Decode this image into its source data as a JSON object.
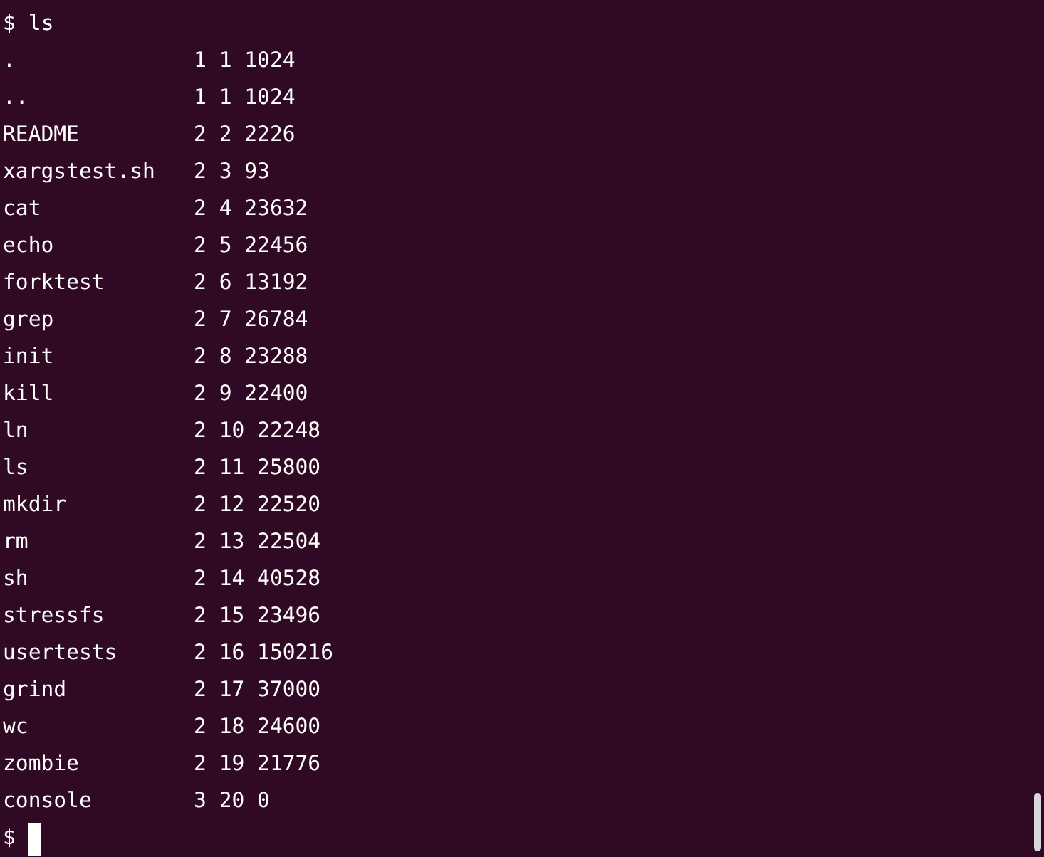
{
  "terminal": {
    "command_line": {
      "prompt": "$",
      "command": "ls"
    },
    "rows": [
      {
        "name": ".",
        "stat": "1 1 1024"
      },
      {
        "name": "..",
        "stat": "1 1 1024"
      },
      {
        "name": "README",
        "stat": "2 2 2226"
      },
      {
        "name": "xargstest.sh",
        "stat": "2 3 93"
      },
      {
        "name": "cat",
        "stat": "2 4 23632"
      },
      {
        "name": "echo",
        "stat": "2 5 22456"
      },
      {
        "name": "forktest",
        "stat": "2 6 13192"
      },
      {
        "name": "grep",
        "stat": "2 7 26784"
      },
      {
        "name": "init",
        "stat": "2 8 23288"
      },
      {
        "name": "kill",
        "stat": "2 9 22400"
      },
      {
        "name": "ln",
        "stat": "2 10 22248"
      },
      {
        "name": "ls",
        "stat": "2 11 25800"
      },
      {
        "name": "mkdir",
        "stat": "2 12 22520"
      },
      {
        "name": "rm",
        "stat": "2 13 22504"
      },
      {
        "name": "sh",
        "stat": "2 14 40528"
      },
      {
        "name": "stressfs",
        "stat": "2 15 23496"
      },
      {
        "name": "usertests",
        "stat": "2 16 150216"
      },
      {
        "name": "grind",
        "stat": "2 17 37000"
      },
      {
        "name": "wc",
        "stat": "2 18 24600"
      },
      {
        "name": "zombie",
        "stat": "2 19 21776"
      },
      {
        "name": "console",
        "stat": "3 20 0"
      }
    ],
    "current_prompt": "$"
  }
}
